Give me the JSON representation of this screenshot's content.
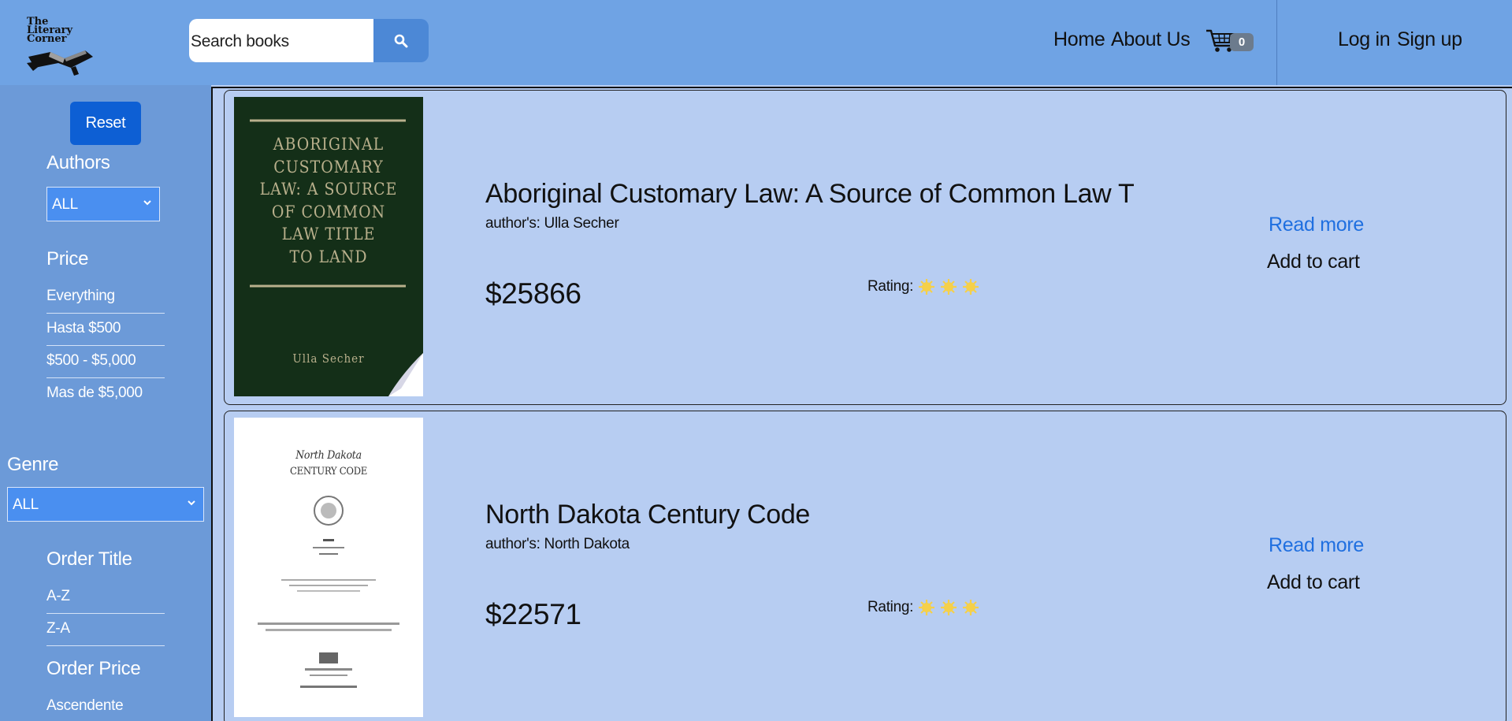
{
  "header": {
    "logo_text": "The Literary Corner",
    "logo_lines": [
      "The",
      "Literary",
      "Corner"
    ],
    "search_placeholder": "Search books",
    "nav": {
      "home": "Home",
      "about": "About Us",
      "cart_count": "0",
      "login": "Log in",
      "signup": "Sign up"
    }
  },
  "sidebar": {
    "reset_label": "Reset",
    "authors": {
      "heading": "Authors",
      "selected": "ALL"
    },
    "price": {
      "heading": "Price",
      "options": [
        "Everything",
        "Hasta $500",
        "$500 - $5,000",
        "Mas de $5,000"
      ]
    },
    "genre": {
      "heading": "Genre",
      "selected": "ALL"
    },
    "order_title": {
      "heading": "Order Title",
      "options": [
        "A-Z",
        "Z-A"
      ]
    },
    "order_price": {
      "heading": "Order Price",
      "options": [
        "Ascendente"
      ]
    }
  },
  "books": [
    {
      "title": "Aboriginal Customary Law: A Source of Common Law T",
      "author": "author's: Ulla Secher",
      "price": "$25866",
      "rating_label": "Rating:",
      "stars": 3,
      "read_more": "Read more",
      "add_to_cart": "Add to cart",
      "cover": {
        "title_lines": [
          "ABORIGINAL",
          "CUSTOMARY",
          "LAW: A SOURCE",
          "OF COMMON",
          "LAW TITLE",
          "TO LAND"
        ],
        "author": "Ulla Secher",
        "bg": "#142f18",
        "fg": "#b9b08c"
      }
    },
    {
      "title": "North Dakota Century Code",
      "author": "author's: North Dakota",
      "price": "$22571",
      "rating_label": "Rating:",
      "stars": 3,
      "read_more": "Read more",
      "add_to_cart": "Add to cart",
      "cover": {
        "title_lines": [
          "North Dakota",
          "CENTURY CODE"
        ],
        "bg": "#ffffff",
        "fg": "#333333"
      }
    }
  ],
  "colors": {
    "header_bg": "#6fa3e4",
    "sidebar_bg": "#6c9ad8",
    "content_bg": "#b7cdf2",
    "accent": "#0d5fd4",
    "link": "#1f6fe0",
    "star": "#f5c518"
  }
}
